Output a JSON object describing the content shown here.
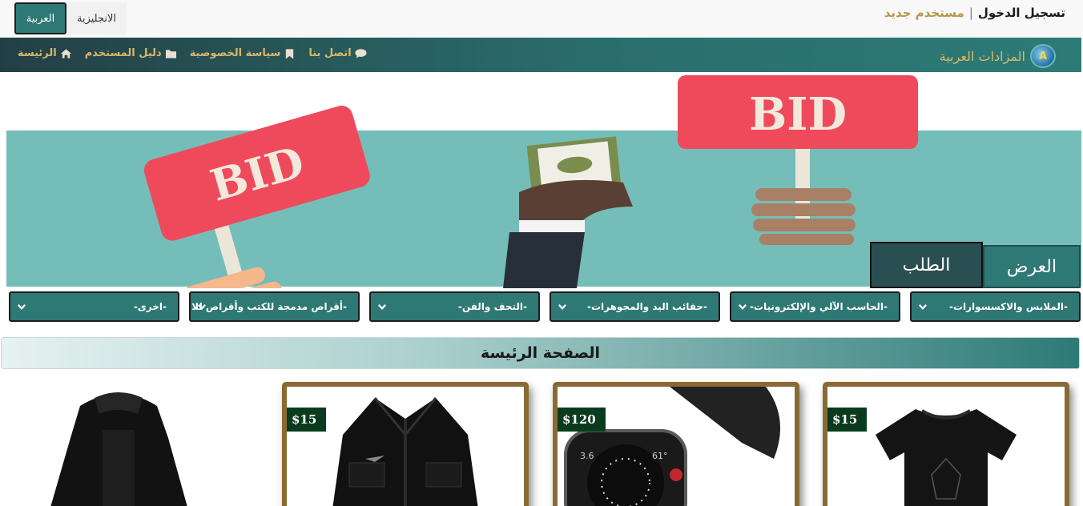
{
  "topbar": {
    "login": "تسجيل الدخول",
    "separator": "|",
    "new_user": "مستخدم جديد",
    "lang_active": "العربية",
    "lang_other": "الانجليزية"
  },
  "navbar": {
    "brand": "المزادات العربية",
    "links": [
      {
        "label": "الرئيسة",
        "icon": "home-icon"
      },
      {
        "label": "دليل المستخدم",
        "icon": "folder-icon"
      },
      {
        "label": "سياسة الخصوصية",
        "icon": "bookmark-icon"
      },
      {
        "label": "اتصل بنا",
        "icon": "comment-icon"
      }
    ]
  },
  "hero": {
    "bid_text": "BID",
    "tab_offer": "العرض",
    "tab_request": "الطلب"
  },
  "categories": [
    "-الملابس والاكسسوارات-",
    "-الحاسب الآلي والإلكترونيات-",
    "-حقائب اليد والمجوهرات-",
    "-التحف والفن-",
    "-أقراص مدمجة للكتب وأقراص للا",
    "-اخرى-"
  ],
  "section": {
    "title": "الصفحة الرئيسة"
  },
  "products": [
    {
      "price": "$15",
      "item": "t-shirt"
    },
    {
      "price": "$120",
      "item": "smartwatch"
    },
    {
      "price": "$15",
      "item": "jacket"
    },
    {
      "price": "",
      "item": "coat"
    }
  ],
  "colors": {
    "teal": "#2e7875",
    "gold": "#d9b86a",
    "price_bg": "#0a3b1e",
    "frame": "#8a6a34"
  }
}
